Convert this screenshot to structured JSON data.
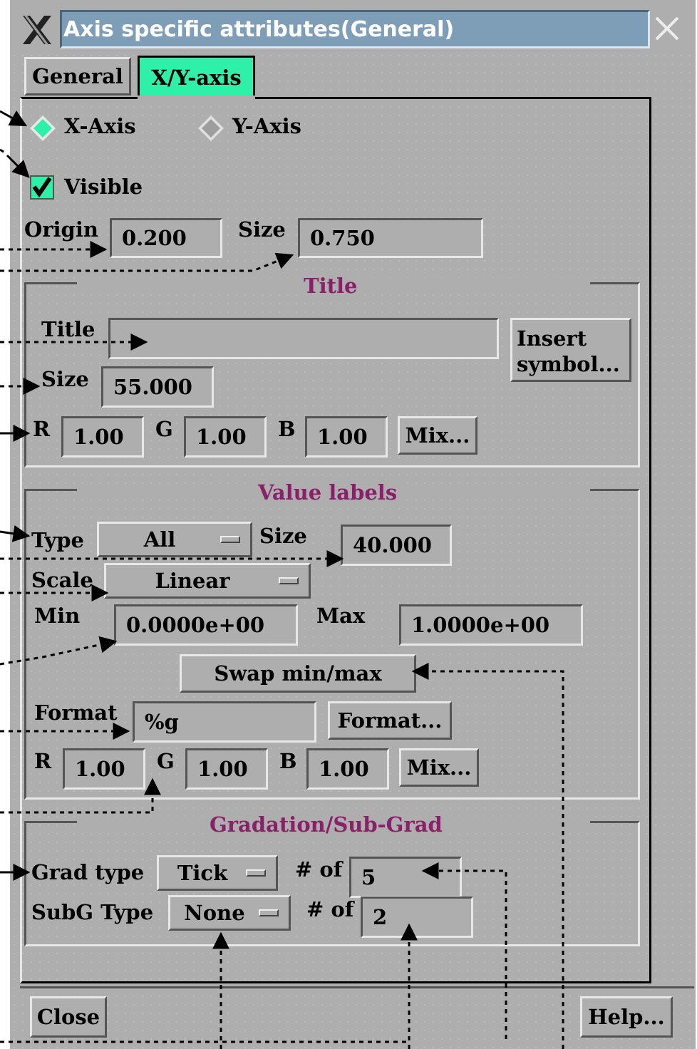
{
  "window": {
    "title": "Axis specific attributes(General)"
  },
  "tabs": [
    {
      "label": "General",
      "active": false
    },
    {
      "label": "X/Y-axis",
      "active": true
    }
  ],
  "axis": {
    "x_label": "X-Axis",
    "y_label": "Y-Axis",
    "selected": "X-Axis",
    "visible_label": "Visible",
    "visible_checked": true,
    "origin_label": "Origin",
    "origin_value": "0.200",
    "size_label": "Size",
    "size_value": "0.750"
  },
  "title_group": {
    "heading": "Title",
    "title_label": "Title",
    "title_value": "",
    "insert_symbol_line1": "Insert",
    "insert_symbol_line2": "symbol...",
    "size_label": "Size",
    "size_value": "55.000",
    "r_label": "R",
    "r_value": "1.00",
    "g_label": "G",
    "g_value": "1.00",
    "b_label": "B",
    "b_value": "1.00",
    "mix_label": "Mix..."
  },
  "value_labels": {
    "heading": "Value labels",
    "type_label": "Type",
    "type_value": "All",
    "size_label": "Size",
    "size_value": "40.000",
    "scale_label": "Scale",
    "scale_value": "Linear",
    "min_label": "Min",
    "min_value": "0.0000e+00",
    "max_label": "Max",
    "max_value": "1.0000e+00",
    "swap_label": "Swap min/max",
    "format_label": "Format",
    "format_value": "%g",
    "format_button": "Format...",
    "r_label": "R",
    "r_value": "1.00",
    "g_label": "G",
    "g_value": "1.00",
    "b_label": "B",
    "b_value": "1.00",
    "mix_label": "Mix..."
  },
  "gradation": {
    "heading": "Gradation/Sub-Grad",
    "grad_type_label": "Grad type",
    "grad_type_value": "Tick",
    "grad_count_label": "# of",
    "grad_count_value": "5",
    "subg_type_label": "SubG Type",
    "subg_type_value": "None",
    "subg_count_label": "# of",
    "subg_count_value": "2"
  },
  "footer": {
    "close_label": "Close",
    "help_label": "Help..."
  },
  "colors": {
    "panel": "#aeaeae",
    "active_tab": "#2ff0a8",
    "group_title": "#8a1f6a",
    "title_bar": "#7e9eb8"
  }
}
